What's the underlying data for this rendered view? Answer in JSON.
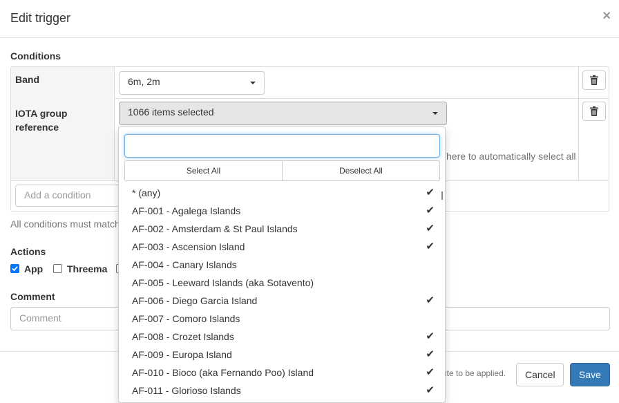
{
  "modal": {
    "title": "Edit trigger",
    "close_symbol": "×"
  },
  "conditions": {
    "heading": "Conditions",
    "band": {
      "label": "Band",
      "value": "6m, 2m"
    },
    "iota": {
      "label_line1": "IOTA group",
      "label_line2": "reference",
      "value": "1066 items selected",
      "hint_partial": "here to automatically select all"
    },
    "add_placeholder": "Add a condition",
    "footnote_partial": "All conditions must match"
  },
  "actions": {
    "heading": "Actions",
    "items": [
      {
        "label": "App",
        "checked": true
      },
      {
        "label": "Threema",
        "checked": false
      }
    ]
  },
  "comment": {
    "heading": "Comment",
    "placeholder": "Comment"
  },
  "footer": {
    "note_partial": "ute to be applied.",
    "cancel": "Cancel",
    "save": "Save"
  },
  "dropdown": {
    "search_value": "",
    "select_all": "Select All",
    "deselect_all": "Deselect All",
    "items": [
      {
        "label": "* (any)",
        "checked": true
      },
      {
        "label": "AF-001 - Agalega Islands",
        "checked": true
      },
      {
        "label": "AF-002 - Amsterdam & St Paul Islands",
        "checked": true
      },
      {
        "label": "AF-003 - Ascension Island",
        "checked": true
      },
      {
        "label": "AF-004 - Canary Islands",
        "checked": false
      },
      {
        "label": "AF-005 - Leeward Islands (aka Sotavento)",
        "checked": false
      },
      {
        "label": "AF-006 - Diego Garcia Island",
        "checked": true
      },
      {
        "label": "AF-007 - Comoro Islands",
        "checked": false
      },
      {
        "label": "AF-008 - Crozet Islands",
        "checked": true
      },
      {
        "label": "AF-009 - Europa Island",
        "checked": true
      },
      {
        "label": "AF-010 - Bioco (aka Fernando Poo) Island",
        "checked": true
      },
      {
        "label": "AF-011 - Glorioso Islands",
        "checked": true
      }
    ]
  },
  "icons": {
    "trash": "trash-icon",
    "check": "check-icon",
    "caret": "caret-down-icon"
  },
  "colors": {
    "primary": "#337ab7",
    "checkbox": "#0075ff"
  }
}
